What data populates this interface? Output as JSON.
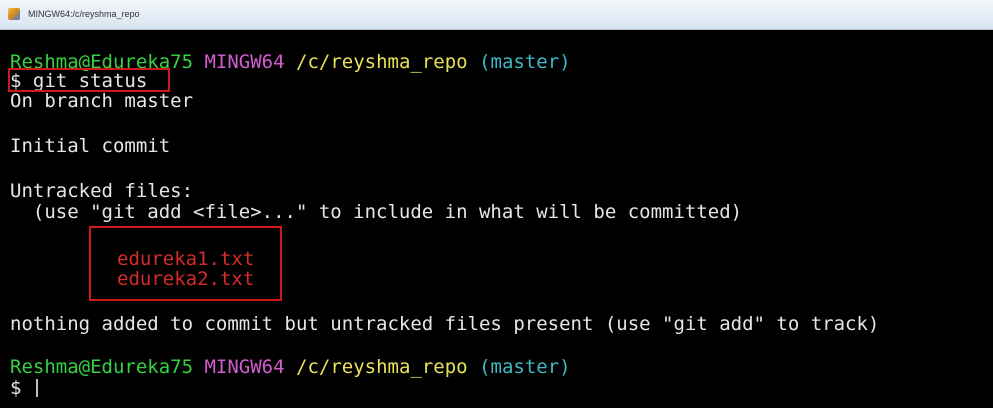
{
  "window": {
    "title": "MINGW64:/c/reyshma_repo"
  },
  "prompt1": {
    "user_host": "Reshma@Edureka75",
    "system": "MINGW64",
    "path": "/c/reyshma_repo",
    "branch": "(master)"
  },
  "command": "$ git status",
  "output": {
    "on_branch": "On branch master",
    "initial_commit": "Initial commit",
    "untracked_header": "Untracked files:",
    "hint": "  (use \"git add <file>...\" to include in what will be committed)",
    "files": [
      "edureka1.txt",
      "edureka2.txt"
    ],
    "summary": "nothing added to commit but untracked files present (use \"git add\" to track)"
  },
  "prompt2": {
    "user_host": "Reshma@Edureka75",
    "system": "MINGW64",
    "path": "/c/reyshma_repo",
    "branch": "(master)"
  },
  "current_input": "$ ",
  "colors": {
    "user_host": "#35d340",
    "system": "#d15cd1",
    "path": "#e9e15a",
    "branch": "#40b8c7",
    "untracked_file": "#d42b2b",
    "highlight_box": "#d11818",
    "background": "#000000",
    "text": "#e6e6e6"
  },
  "icons": {
    "window_icon": "git-bash-icon"
  }
}
